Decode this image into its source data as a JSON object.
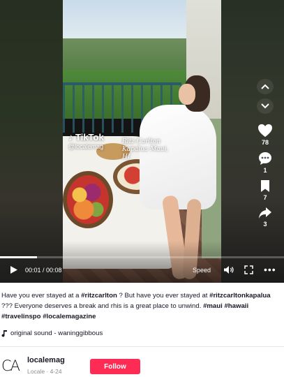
{
  "video": {
    "watermark_logo": "TikTok",
    "watermark_user": "@localemag",
    "overlay_caption": "Ritz Carlton Kapalua Maui, HI",
    "progress_fraction": 0.13,
    "controls": {
      "time_text": "00:01 / 00:08",
      "speed_label": "Speed",
      "more_label": "•••"
    },
    "actions": {
      "likes": "78",
      "comments": "1",
      "saves": "7",
      "shares": "3"
    },
    "icons": {
      "up": "chevron-up-icon",
      "down": "chevron-down-icon",
      "like": "heart-icon",
      "comment": "comment-icon",
      "save": "bookmark-icon",
      "share": "share-arrow-icon",
      "play": "play-icon",
      "volume": "volume-icon",
      "fullscreen": "fullscreen-icon"
    }
  },
  "caption": {
    "p1": "Have you ever stayed at a ",
    "t1": "#ritzcarlton",
    "p2": " ? But have you ever stayed at ",
    "t2": "#ritzcarltonkapalua",
    "p3": " ??? Everyone deserves a break and rhis is a great place to unwind. ",
    "t3": "#maui",
    "p4": " ",
    "t4": "#hawaii",
    "p5": " ",
    "t5": "#travelinspo",
    "p6": " ",
    "t6": "#localemagazine"
  },
  "sound": {
    "icon": "music-note-icon",
    "text": "original sound - waninggibbous"
  },
  "author": {
    "avatar_text": "CA",
    "username": "localemag",
    "meta": "Locale · 4-24",
    "follow_label": "Follow"
  },
  "colors": {
    "follow": "#fe2c55",
    "text": "#161823",
    "muted": "#8a8b91"
  }
}
